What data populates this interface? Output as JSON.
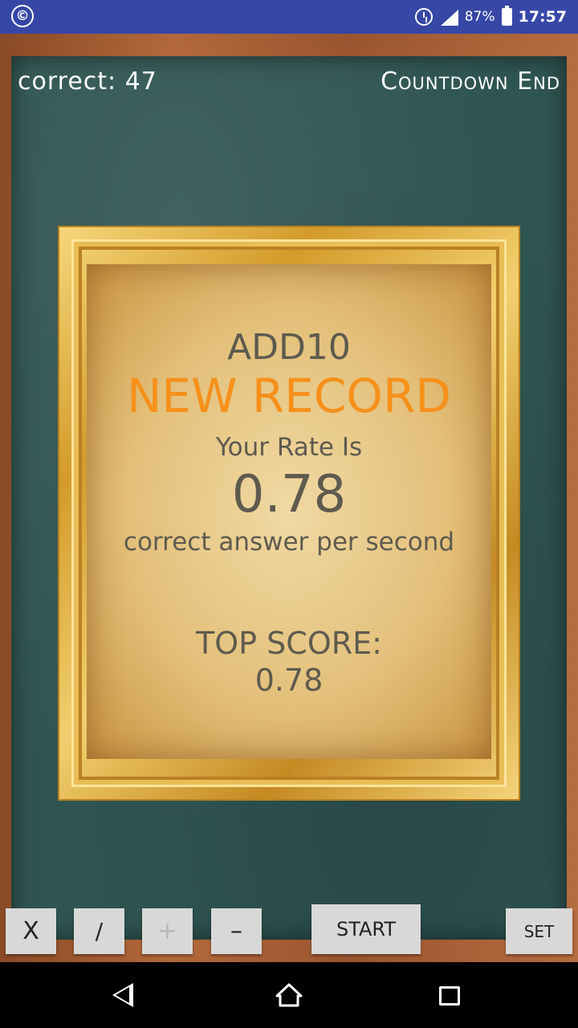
{
  "status_bar": {
    "left_icon": "copyright-icon",
    "left_glyph": "©",
    "battery": "87%",
    "time": "17:57"
  },
  "header": {
    "correct_text": "correct: 47",
    "countdown_text": "Countdown End"
  },
  "result": {
    "mode": "ADD10",
    "record_banner": "NEW RECORD",
    "rate_label": "Your Rate Is",
    "rate_value": "0.78",
    "rate_unit": "correct answer per second",
    "top_score_label": "TOP SCORE:",
    "top_score_value": "0.78"
  },
  "buttons": {
    "multiply": "X",
    "divide": "/",
    "add": "+",
    "subtract": "–",
    "start": "START",
    "set": "SET"
  },
  "colors": {
    "status_bar": "#3747a6",
    "chalkboard": "#2f5552",
    "record_orange": "#f6901a",
    "paper_text": "#5e5a4e"
  }
}
